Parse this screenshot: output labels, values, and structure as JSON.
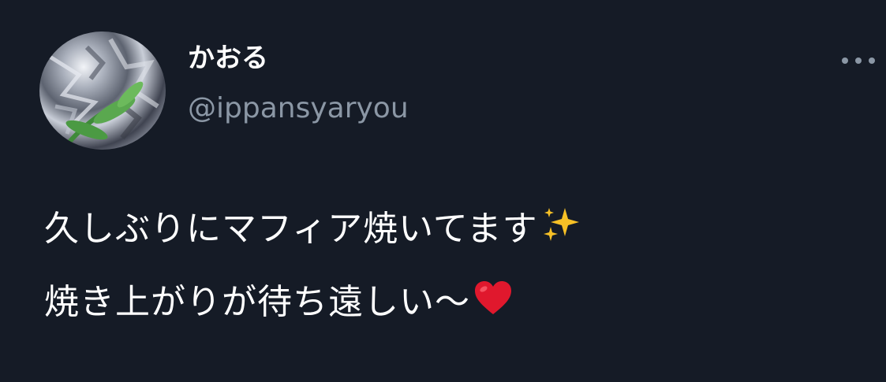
{
  "tweet": {
    "author": {
      "display_name": "かおる",
      "handle": "@ippansyaryou",
      "avatar_icon": "profile-photo-foil-plant"
    },
    "more_icon": "more-horizontal-icon",
    "body": {
      "line1": "久しぶりにマフィア焼いてます",
      "line1_emoji": "sparkles-icon",
      "line2": "焼き上がりが待ち遠しい〜",
      "line2_emoji": "red-heart-icon"
    }
  },
  "colors": {
    "background": "#151b26",
    "text_primary": "#ffffff",
    "text_secondary": "#8b97a5",
    "heart": "#e0182d",
    "sparkle": "#f6c026"
  }
}
